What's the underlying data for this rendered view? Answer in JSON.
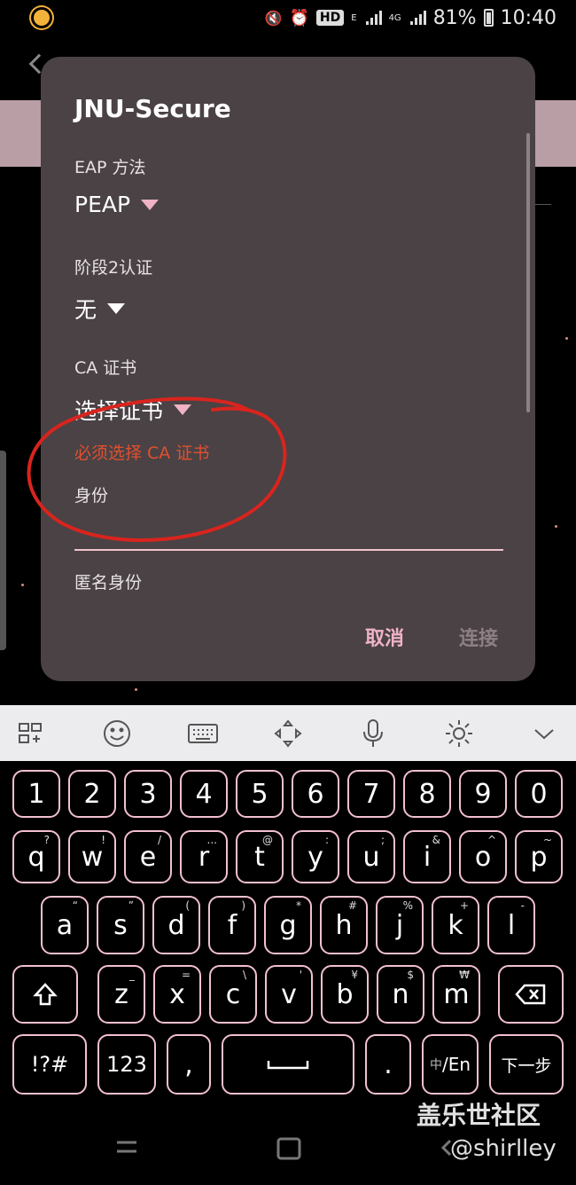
{
  "status": {
    "battery": "81%",
    "time": "10:40",
    "network": "4G",
    "hd": "HD",
    "signal_e": "E"
  },
  "dialog": {
    "title": "JNU-Secure",
    "eap_label": "EAP 方法",
    "eap_value": "PEAP",
    "phase2_label": "阶段2认证",
    "phase2_value": "无",
    "ca_label": "CA 证书",
    "ca_value": "选择证书",
    "ca_error": "必须选择 CA 证书",
    "identity_label": "身份",
    "anon_identity_label": "匿名身份",
    "cancel": "取消",
    "connect": "连接"
  },
  "keyboard": {
    "row_numbers": [
      "1",
      "2",
      "3",
      "4",
      "5",
      "6",
      "7",
      "8",
      "9",
      "0"
    ],
    "row_q": [
      {
        "k": "q",
        "h": "?"
      },
      {
        "k": "w",
        "h": "!"
      },
      {
        "k": "e",
        "h": "/"
      },
      {
        "k": "r",
        "h": "..."
      },
      {
        "k": "t",
        "h": "@"
      },
      {
        "k": "y",
        "h": ":"
      },
      {
        "k": "u",
        "h": ";"
      },
      {
        "k": "i",
        "h": "&"
      },
      {
        "k": "o",
        "h": "^"
      },
      {
        "k": "p",
        "h": "~"
      }
    ],
    "row_a": [
      {
        "k": "a",
        "h": "“"
      },
      {
        "k": "s",
        "h": "”"
      },
      {
        "k": "d",
        "h": "("
      },
      {
        "k": "f",
        "h": ")"
      },
      {
        "k": "g",
        "h": "*"
      },
      {
        "k": "h",
        "h": "#"
      },
      {
        "k": "j",
        "h": "%"
      },
      {
        "k": "k",
        "h": "+"
      },
      {
        "k": "l",
        "h": "-"
      }
    ],
    "row_z": [
      {
        "k": "z",
        "h": "_"
      },
      {
        "k": "x",
        "h": "="
      },
      {
        "k": "c",
        "h": "\\"
      },
      {
        "k": "v",
        "h": "'"
      },
      {
        "k": "b",
        "h": "¥"
      },
      {
        "k": "n",
        "h": "$"
      },
      {
        "k": "m",
        "h": "₩"
      }
    ],
    "sym_key": "!?#",
    "num_key": "123",
    "comma": ",",
    "period": ".",
    "lang_cn": "中",
    "lang_en": "/En",
    "next": "下一步"
  },
  "watermark": {
    "site": "盖乐世社区",
    "user": "@shirlley"
  },
  "colors": {
    "accent_pink": "#f0b3c6",
    "error_red": "#e0502e",
    "dialog_bg": "#4a4245"
  }
}
